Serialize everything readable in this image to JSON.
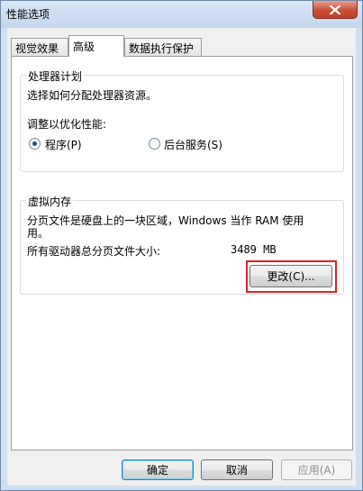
{
  "window": {
    "title": "性能选项",
    "close_icon": "close-icon"
  },
  "tabs": [
    {
      "label": "视觉效果",
      "active": false
    },
    {
      "label": "高级",
      "active": true
    },
    {
      "label": "数据执行保护",
      "active": false
    }
  ],
  "processor": {
    "title": "处理器计划",
    "description": "选择如何分配处理器资源。",
    "adjust_label": "调整以优化性能:",
    "options": [
      {
        "label": "程序(P)",
        "selected": true
      },
      {
        "label": "后台服务(S)",
        "selected": false
      }
    ]
  },
  "virtual_memory": {
    "title": "虚拟内存",
    "description_line1": "分页文件是硬盘上的一块区域，Windows 当作 RAM 使用",
    "description_line2": "用。",
    "total_label": "所有驱动器总分页文件大小:",
    "total_value": "3489 MB",
    "change_button": "更改(C)..."
  },
  "footer": {
    "ok": "确定",
    "cancel": "取消",
    "apply": "应用(A)"
  },
  "colors": {
    "highlight": "#e0202a",
    "accent": "#1b4e96"
  }
}
